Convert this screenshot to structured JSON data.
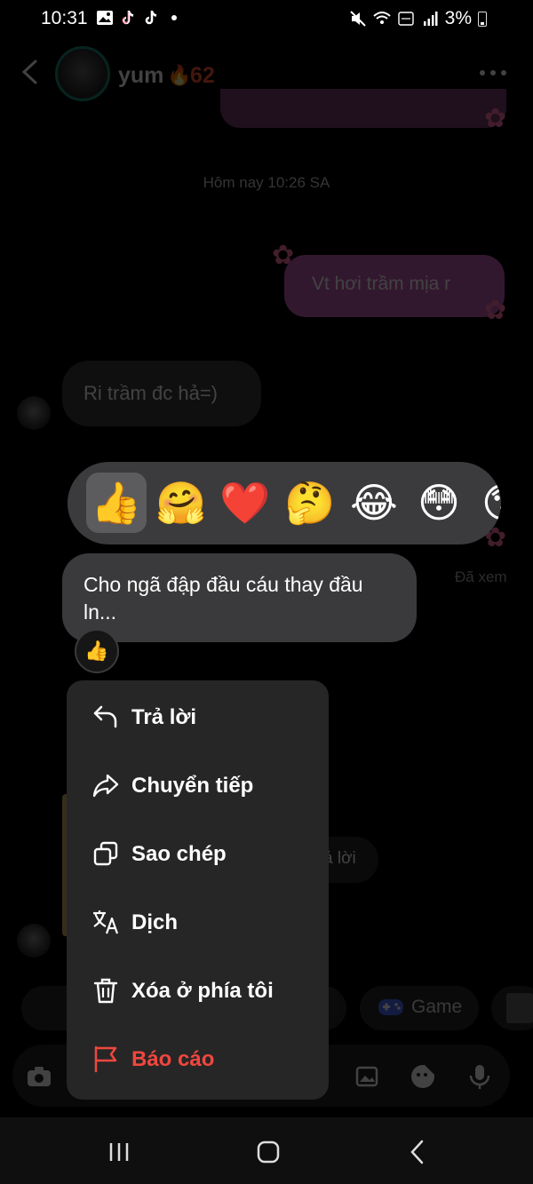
{
  "status_bar": {
    "time": "10:31",
    "battery": "3%"
  },
  "header": {
    "name": "yum",
    "streak_count": "62"
  },
  "conversation": {
    "timestamp": "Hôm nay 10:26 SA",
    "my_message": "Vt hơi trầm mịa r",
    "their_message": "Ri trầm đc hả=)",
    "seen_label": "Đã xem",
    "reply_chip_text": "ả lời",
    "game_chip_label": "Game"
  },
  "reaction_bar": {
    "emojis": [
      "👍",
      "🤗",
      "❤️",
      "🤔",
      "😂",
      "😳",
      "😯"
    ],
    "selected_index": 0
  },
  "focused_message": {
    "text": "Cho ngã đập đầu cáu thay đầu ln...",
    "reaction": "👍"
  },
  "context_menu": {
    "items": [
      {
        "label": "Trả lời",
        "icon": "reply-icon"
      },
      {
        "label": "Chuyển tiếp",
        "icon": "forward-icon"
      },
      {
        "label": "Sao chép",
        "icon": "copy-icon"
      },
      {
        "label": "Dịch",
        "icon": "translate-icon"
      },
      {
        "label": "Xóa ở phía tôi",
        "icon": "trash-icon"
      },
      {
        "label": "Báo cáo",
        "icon": "flag-icon"
      }
    ]
  },
  "colors": {
    "menu_background": "#262626",
    "danger": "#f0473f",
    "reaction_bar": "#3b3b3d",
    "my_bubble": "#c25cb3"
  }
}
